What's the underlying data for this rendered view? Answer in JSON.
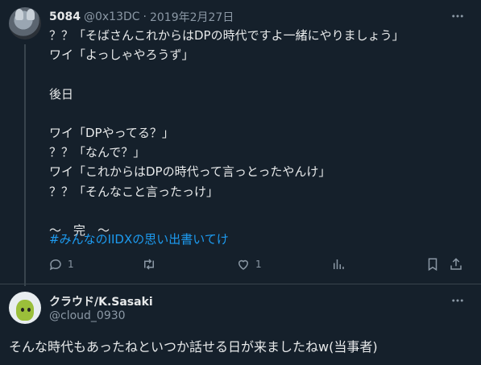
{
  "tweet": {
    "display_name": "5084",
    "handle": "@0x13DC",
    "separator": "·",
    "date": "2019年2月27日",
    "text": "？？「そばさんこれからはDPの時代ですよ一緒にやりましょう」\nワイ「よっしゃやろうず」\n\n後日\n\nワイ「DPやってる？」\n？？「なんで？」\nワイ「これからはDPの時代って言っとったやんけ」\n？？「そんなこと言ったっけ」\n\n～　完　～",
    "hashtag": "#みんなのIIDXの思い出書いてけ",
    "reply_count": "1",
    "like_count": "1"
  },
  "reply": {
    "display_name": "クラウド/K.Sasaki",
    "handle": "@cloud_0930",
    "text": "そんな時代もあったねといつか話せる日が来ましたねw(当事者)"
  },
  "icons": [
    "more-icon",
    "reply-icon",
    "retweet-icon",
    "like-icon",
    "views-icon",
    "bookmark-icon",
    "share-icon"
  ],
  "colors": {
    "background": "#15202b",
    "text": "#e7e9ea",
    "secondary": "#8b98a5",
    "link": "#1d9bf0",
    "border": "#38444d"
  }
}
